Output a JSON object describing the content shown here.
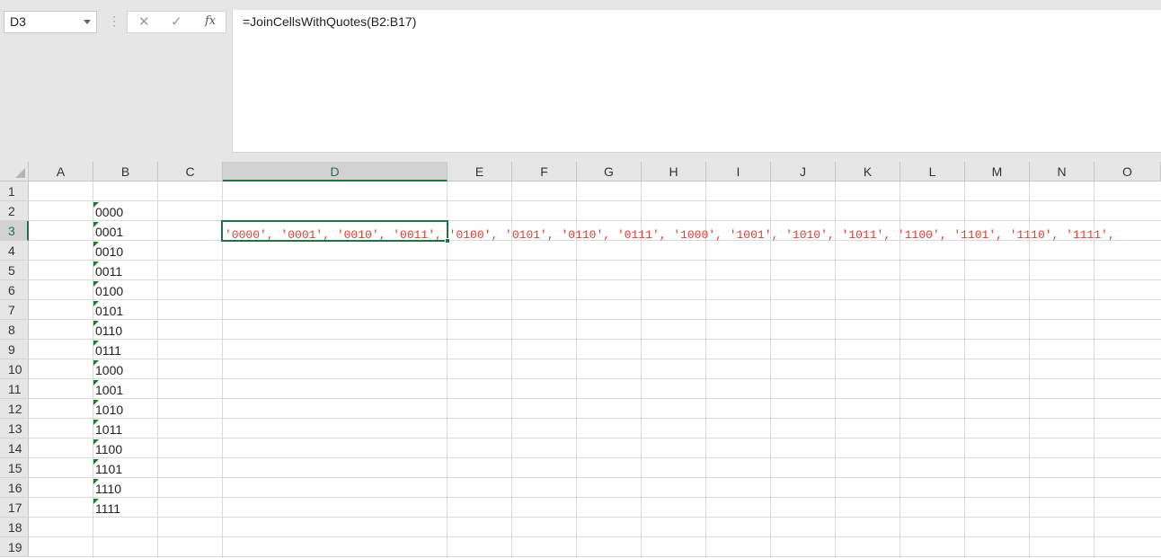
{
  "formula_bar": {
    "name_box": "D3",
    "cancel_glyph": "✕",
    "enter_glyph": "✓",
    "fx_label": "fx",
    "formula": "=JoinCellsWithQuotes(B2:B17)"
  },
  "grid": {
    "columns": [
      "A",
      "B",
      "C",
      "D",
      "E",
      "F",
      "G",
      "H",
      "I",
      "J",
      "K",
      "L",
      "M",
      "N",
      "O"
    ],
    "selected_column": "D",
    "rows": [
      "1",
      "2",
      "3",
      "4",
      "5",
      "6",
      "7",
      "8",
      "9",
      "10",
      "11",
      "12",
      "13",
      "14",
      "15",
      "16",
      "17",
      "18",
      "19"
    ],
    "selected_row": "3",
    "column_b_values": [
      "0000",
      "0001",
      "0010",
      "0011",
      "0100",
      "0101",
      "0110",
      "0111",
      "1000",
      "1001",
      "1010",
      "1011",
      "1100",
      "1101",
      "1110",
      "1111"
    ],
    "d3_value": "'0000', '0001', '0010', '0011', '0100', '0101', '0110', '0111', '1000', '1001', '1010', '1011', '1100', '1101', '1110', '1111',",
    "d3_color": "#e03c31",
    "accent_color": "#217346",
    "text_indicator_color": "#1e7b34"
  }
}
